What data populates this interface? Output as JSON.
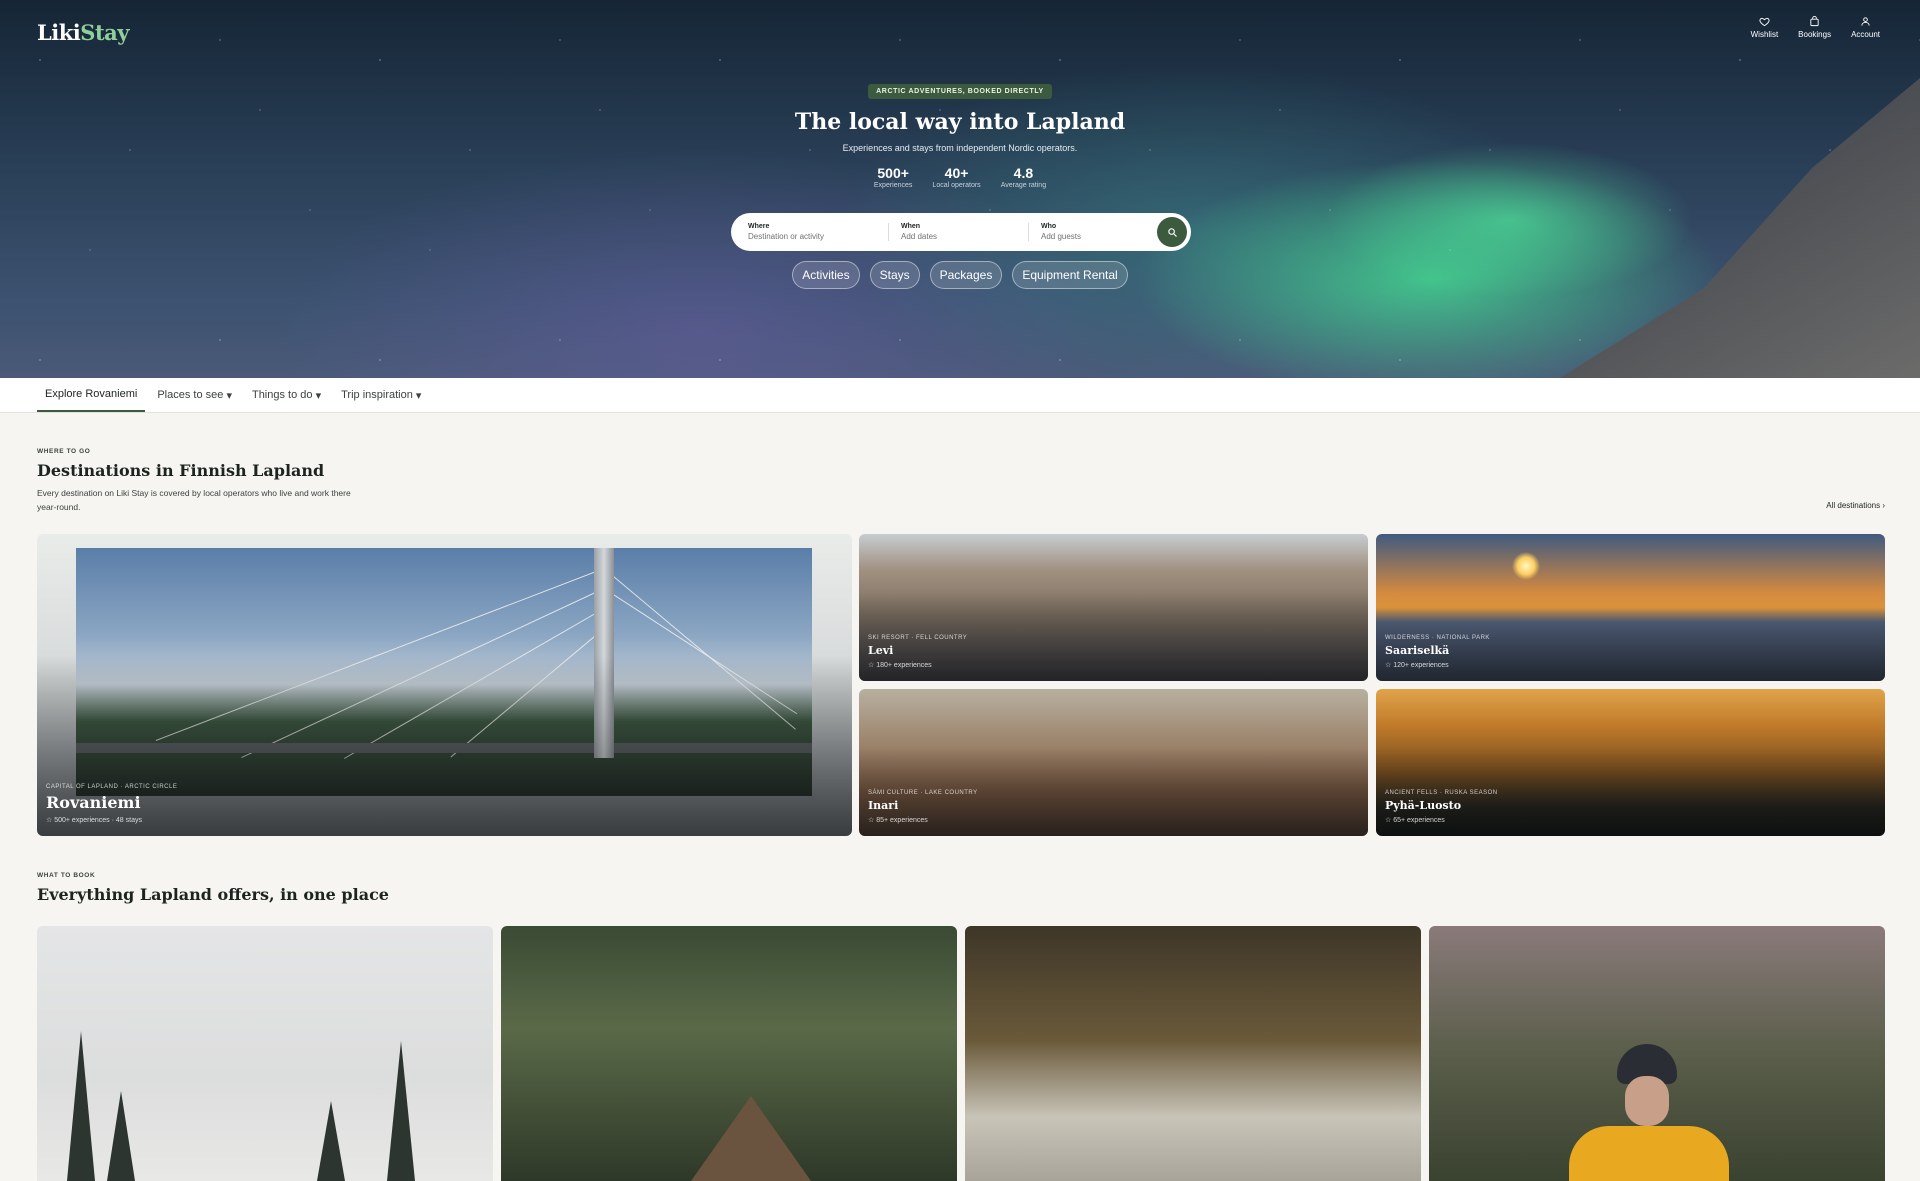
{
  "app": {
    "logo_part1": "Liki",
    "logo_part2": "Stay"
  },
  "topnav": [
    {
      "label": "Wishlist",
      "icon": "heart-icon"
    },
    {
      "label": "Bookings",
      "icon": "bag-icon"
    },
    {
      "label": "Account",
      "icon": "user-icon"
    }
  ],
  "hero": {
    "pill": "ARCTIC ADVENTURES, BOOKED DIRECTLY",
    "title": "The local way into Lapland",
    "subtitle": "Experiences and stays from independent Nordic operators.",
    "stats": [
      {
        "value": "500+",
        "label": "Experiences"
      },
      {
        "value": "40+",
        "label": "Local operators"
      },
      {
        "value": "4.8",
        "label": "Average rating"
      }
    ]
  },
  "search": {
    "where_label": "Where",
    "where_placeholder": "Destination or activity",
    "when_label": "When",
    "when_placeholder": "Add dates",
    "who_label": "Who",
    "who_placeholder": "Add guests"
  },
  "categories": [
    "Activities",
    "Stays",
    "Packages",
    "Equipment Rental"
  ],
  "subnav": [
    {
      "label": "Explore Rovaniemi",
      "dropdown": false,
      "active": true
    },
    {
      "label": "Places to see",
      "dropdown": true,
      "active": false
    },
    {
      "label": "Things to do",
      "dropdown": true,
      "active": false
    },
    {
      "label": "Trip inspiration",
      "dropdown": true,
      "active": false
    }
  ],
  "destinations": {
    "eyebrow": "WHERE TO GO",
    "title": "Destinations in Finnish Lapland",
    "description": "Every destination on Liki Stay is covered by local operators who live and work there year-round.",
    "all_link": "All destinations ›",
    "cards": [
      {
        "tag": "CAPITAL OF LAPLAND · ARCTIC CIRCLE",
        "name": "Rovaniemi",
        "count": "☆ 500+ experiences · 48 stays"
      },
      {
        "tag": "SKI RESORT · FELL COUNTRY",
        "name": "Levi",
        "count": "☆ 180+ experiences"
      },
      {
        "tag": "WILDERNESS · NATIONAL PARK",
        "name": "Saariselkä",
        "count": "☆ 120+ experiences"
      },
      {
        "tag": "SÁMI CULTURE · LAKE COUNTRY",
        "name": "Inari",
        "count": "☆ 85+ experiences"
      },
      {
        "tag": "ANCIENT FELLS · RUSKA SEASON",
        "name": "Pyhä-Luosto",
        "count": "☆ 65+ experiences"
      }
    ]
  },
  "offers": {
    "eyebrow": "WHAT TO BOOK",
    "title": "Everything Lapland offers, in one place"
  },
  "colors": {
    "brand_green": "#3b5a3e",
    "logo_accent": "#8fcf9a",
    "page_bg": "#f6f5f1"
  }
}
